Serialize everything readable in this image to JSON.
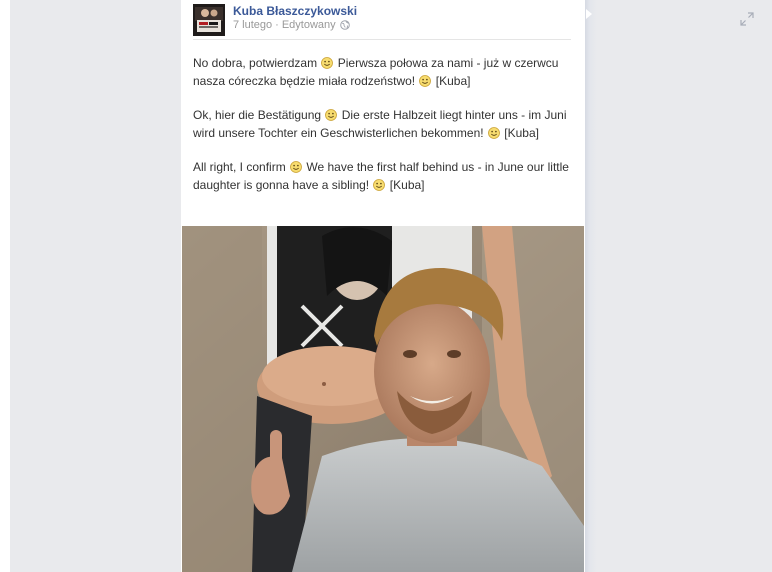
{
  "post": {
    "author": "Kuba Błaszczykowski",
    "date": "7 lutego",
    "separator": "·",
    "edited_label": "Edytowany",
    "paragraphs": [
      {
        "parts": [
          "No dobra, potwierdzam ",
          " Pierwsza połowa za nami - już w czerwcu nasza córeczka będzie miała rodzeństwo! ",
          " [Kuba]"
        ]
      },
      {
        "parts": [
          "Ok, hier die Bestätigung ",
          " Die erste Halbzeit liegt hinter uns - im Juni wird unsere Tochter ein Geschwisterlichen bekommen! ",
          " [Kuba]"
        ]
      },
      {
        "parts": [
          "All right, I confirm ",
          " We have the first half behind us - in June our little daughter is gonna have a sibling! ",
          " [Kuba]"
        ]
      }
    ]
  },
  "icons": {
    "expand": "expand-arrows-icon",
    "privacy": "globe-icon",
    "emoticon": "smiley-icon"
  },
  "colors": {
    "author_link": "#3b5998",
    "meta_text": "#999999",
    "body_text": "#333333",
    "page_background": "#e9eaed",
    "card_background": "#ffffff"
  }
}
